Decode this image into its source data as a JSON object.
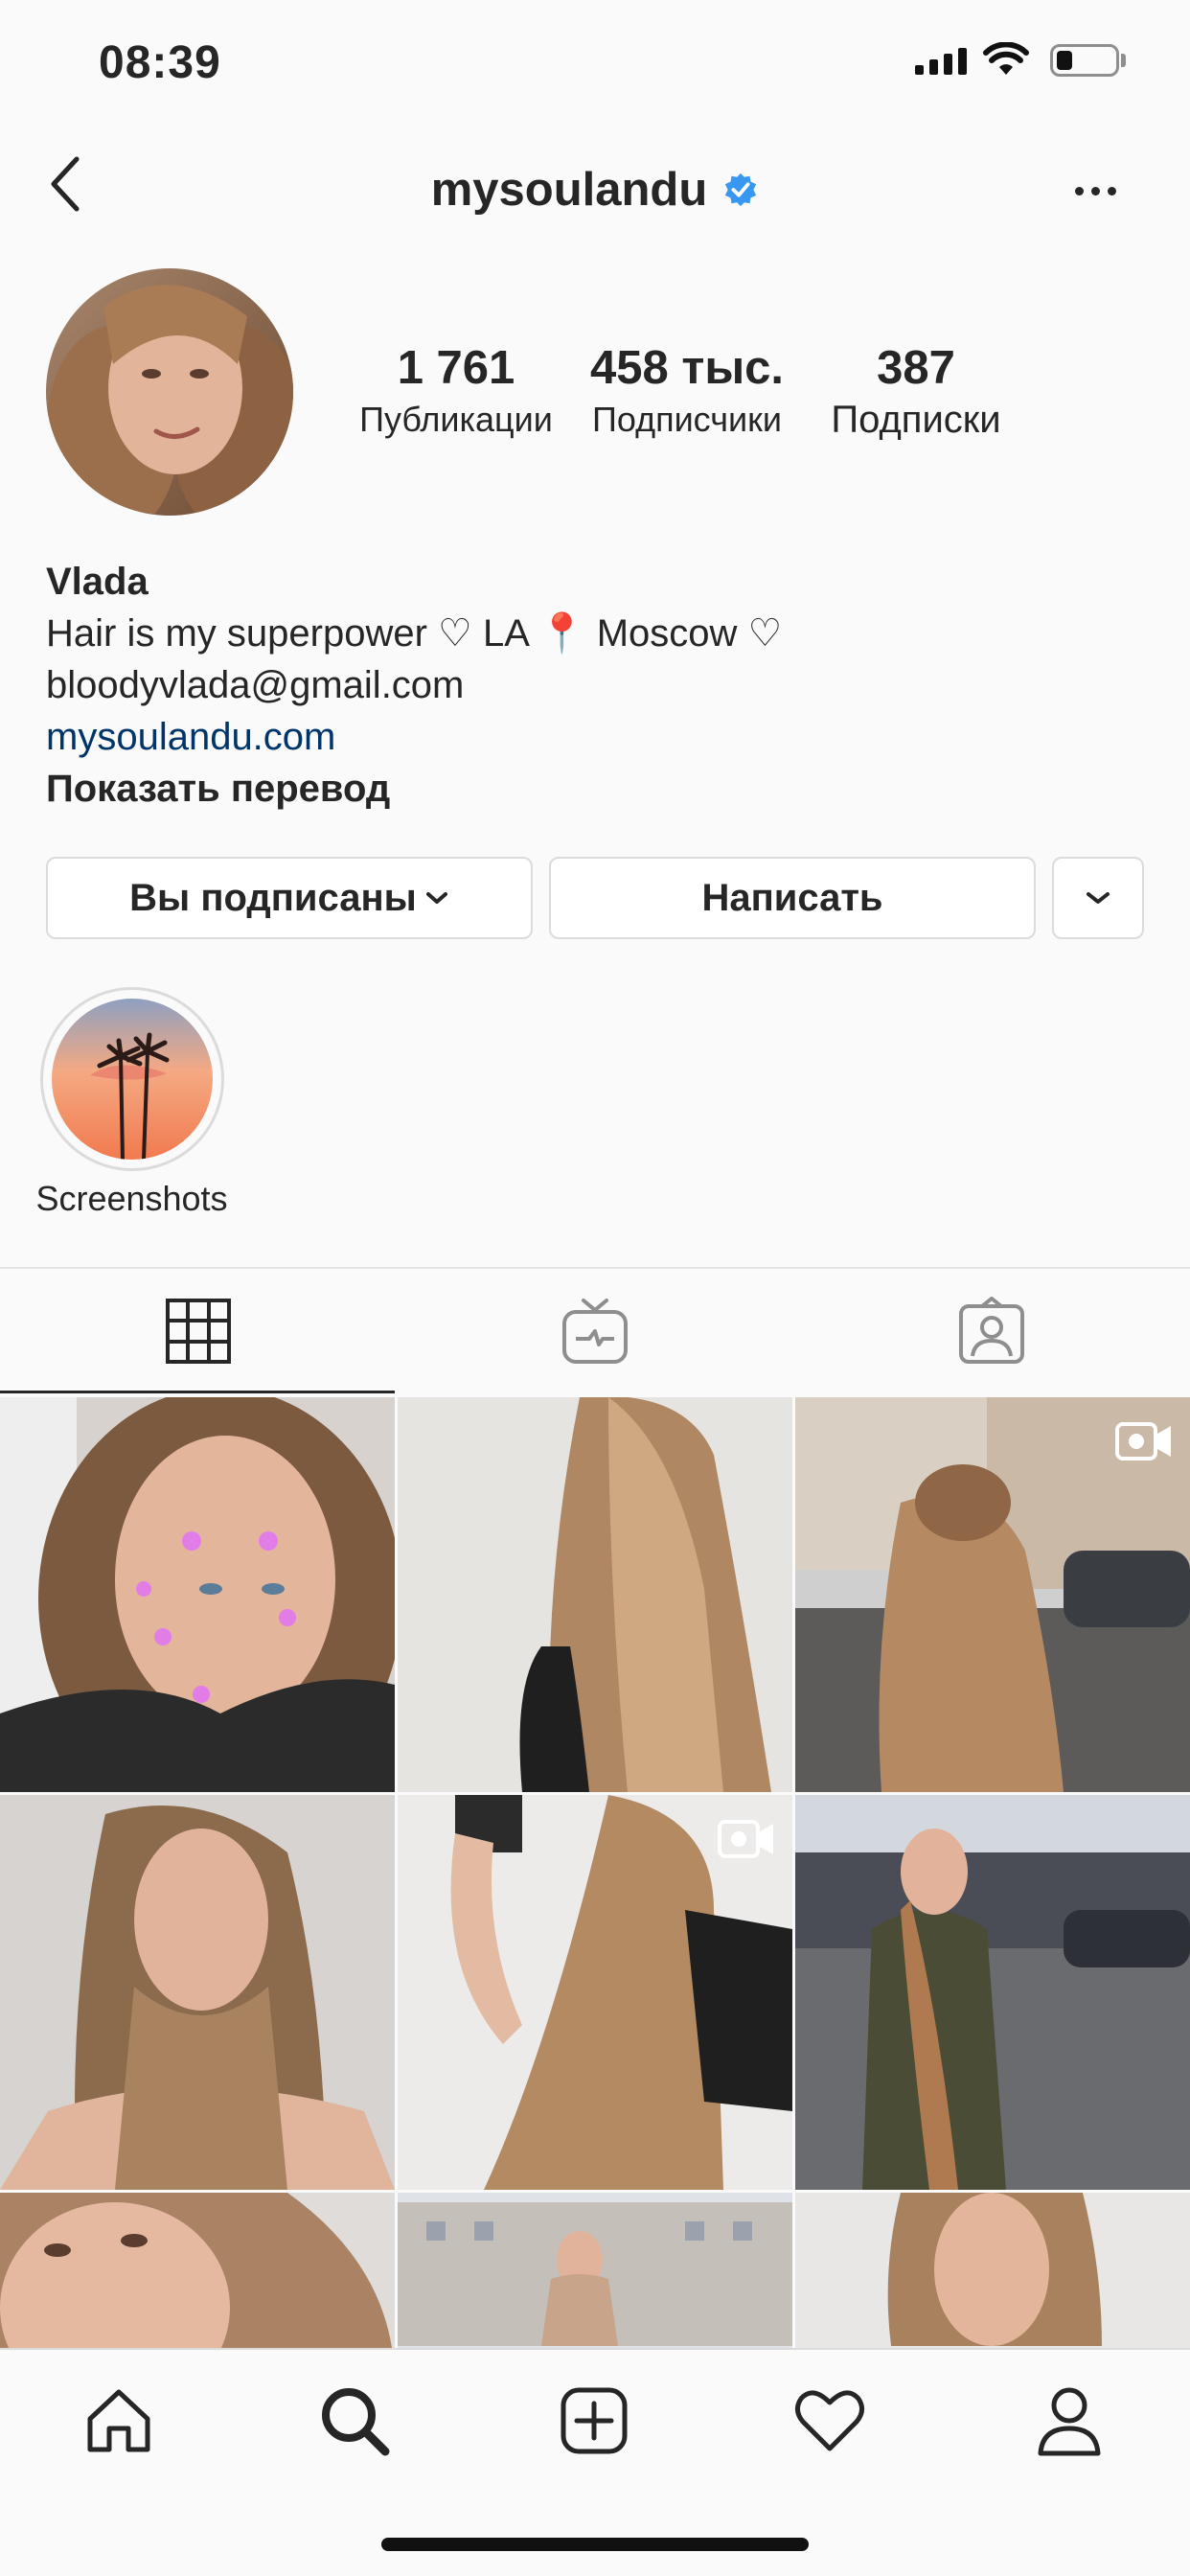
{
  "status_bar": {
    "time": "08:39"
  },
  "header": {
    "username": "mysoulandu"
  },
  "profile": {
    "stats": [
      {
        "value": "1 761",
        "label": "Публикации"
      },
      {
        "value": "458 тыс.",
        "label": "Подписчики"
      },
      {
        "value": "387",
        "label": "Подписки"
      }
    ],
    "name": "Vlada",
    "bio_line": "Hair is my superpower ♡ LA 📍 Moscow ♡",
    "email": "bloodyvlada@gmail.com",
    "website": "mysoulandu.com",
    "translate_label": "Показать перевод"
  },
  "actions": {
    "following_label": "Вы подписаны",
    "message_label": "Написать"
  },
  "highlights": [
    {
      "label": "Screenshots"
    }
  ],
  "colors": {
    "verified": "#3897f0",
    "link": "#003569",
    "border": "#dbdbdb"
  }
}
